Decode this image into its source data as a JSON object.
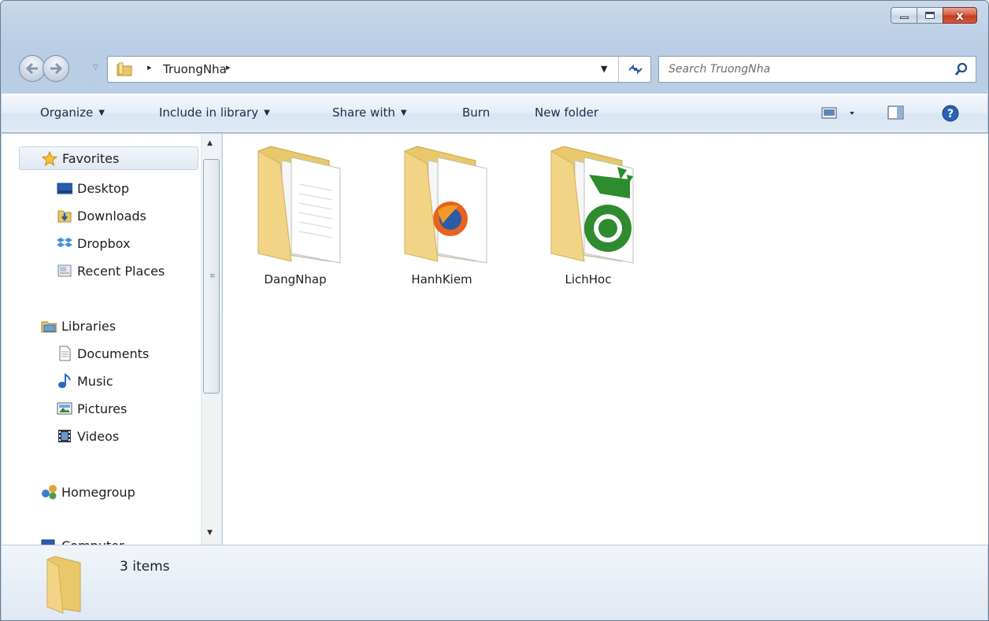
{
  "window": {
    "caption": {
      "min_glyph": "",
      "max_glyph": "",
      "close_glyph": "x"
    }
  },
  "address": {
    "crumbs": [
      "TruongNha"
    ],
    "separator": "▸"
  },
  "search": {
    "placeholder": "Search TruongNha"
  },
  "toolbar": {
    "organize": "Organize",
    "include_in_library": "Include in library",
    "share_with": "Share with",
    "burn": "Burn",
    "new_folder": "New folder"
  },
  "sidebar": {
    "favorites": {
      "label": "Favorites",
      "items": [
        {
          "label": "Desktop",
          "icon": "desktop-icon"
        },
        {
          "label": "Downloads",
          "icon": "downloads-icon"
        },
        {
          "label": "Dropbox",
          "icon": "dropbox-icon"
        },
        {
          "label": "Recent Places",
          "icon": "recent-places-icon"
        }
      ]
    },
    "libraries": {
      "label": "Libraries",
      "items": [
        {
          "label": "Documents",
          "icon": "documents-icon"
        },
        {
          "label": "Music",
          "icon": "music-icon"
        },
        {
          "label": "Pictures",
          "icon": "pictures-icon"
        },
        {
          "label": "Videos",
          "icon": "videos-icon"
        }
      ]
    },
    "homegroup": {
      "label": "Homegroup"
    },
    "computer": {
      "label": "Computer"
    }
  },
  "files": [
    {
      "name": "DangNhap",
      "icon": "folder-with-documents-icon"
    },
    {
      "name": "HanhKiem",
      "icon": "folder-with-firefox-icon"
    },
    {
      "name": "LichHoc",
      "icon": "folder-with-green-app-icon"
    }
  ],
  "details": {
    "count": "3 items"
  },
  "colors": {
    "folder": "#f2d486",
    "accent_blue": "#2d5e9e",
    "close_red": "#c23b23"
  }
}
